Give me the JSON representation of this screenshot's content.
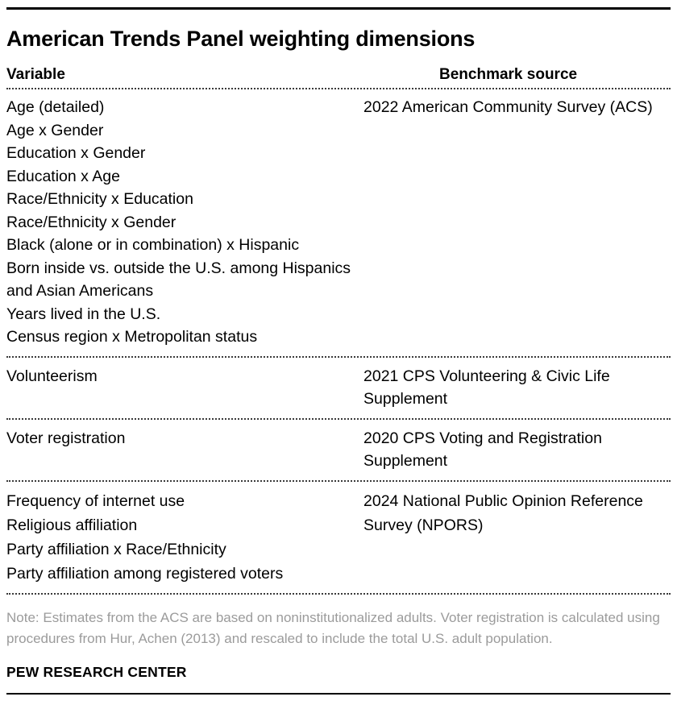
{
  "title": "American Trends Panel weighting dimensions",
  "table": {
    "headers": {
      "variable": "Variable",
      "benchmark": "Benchmark source"
    },
    "groups": [
      {
        "variables": [
          "Age (detailed)",
          "Age x Gender",
          "Education x Gender",
          "Education x Age",
          "Race/Ethnicity x Education",
          "Race/Ethnicity x Gender",
          "Black (alone or in combination) x Hispanic",
          "Born inside vs. outside the U.S. among Hispanics and Asian Americans",
          "Years lived in the U.S.",
          "Census region x Metropolitan status"
        ],
        "source": "2022 American Community Survey (ACS)"
      },
      {
        "variables": [
          "Volunteerism"
        ],
        "source": "2021 CPS Volunteering & Civic Life Supplement"
      },
      {
        "variables": [
          "Voter registration"
        ],
        "source": "2020 CPS Voting and Registration Supplement"
      },
      {
        "variables": [
          "Frequency of internet use",
          "Religious affiliation",
          "Party affiliation x Race/Ethnicity",
          "Party affiliation among registered voters"
        ],
        "source": "2024 National Public Opinion Reference Survey (NPORS)"
      }
    ]
  },
  "note": "Note: Estimates from the ACS are based on noninstitutionalized adults. Voter registration is calculated using procedures from Hur, Achen (2013) and rescaled to include the total U.S. adult population.",
  "footer": "PEW RESEARCH CENTER",
  "colors": {
    "text": "#000000",
    "note": "#9b9b9b",
    "rule": "#000000",
    "dotted": "#3a3a3a"
  }
}
